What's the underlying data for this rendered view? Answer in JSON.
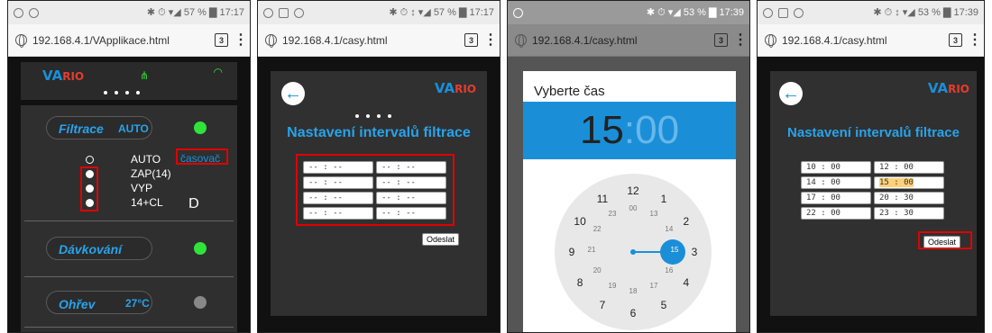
{
  "colors": {
    "accent": "#1a8fd8",
    "highlight_box": "#e00000",
    "led_on": "#2fe33a",
    "led_off": "#888888"
  },
  "screens": [
    {
      "status": {
        "left_icons": [
          "dnd-icon",
          "browser-icon"
        ],
        "right": "✱ ⏱ ▾◢ 57 % ▇ 17:17"
      },
      "url": "192.168.4.1/VApplikace.html",
      "tab_count": "3",
      "logo": {
        "main": "VA",
        "accent": "RIO"
      },
      "sections": [
        {
          "name": "Filtrace",
          "value": "AUTO",
          "led": "on"
        },
        {
          "name": "Dávkování",
          "value": "",
          "led": "on"
        },
        {
          "name": "Ohřev",
          "value": "27°C",
          "led": "off"
        }
      ],
      "options": [
        "AUTO",
        "ZAP(14)",
        "VYP",
        "14+CL"
      ],
      "timer_link": "časovač",
      "collapse_icon": "Ɑ"
    },
    {
      "status": {
        "left_icons": [
          "dnd-icon",
          "image-icon",
          "browser-icon"
        ],
        "right": "✱ ⏱ ↕ ▾◢ 57 % ▇ 17:17"
      },
      "url": "192.168.4.1/casy.html",
      "tab_count": "3",
      "logo": {
        "main": "VA",
        "accent": "RIO"
      },
      "title": "Nastavení intervalů filtrace",
      "intervals": [
        [
          "-- : --",
          "-- : --"
        ],
        [
          "-- : --",
          "-- : --"
        ],
        [
          "-- : --",
          "-- : --"
        ],
        [
          "-- : --",
          "-- : --"
        ]
      ],
      "send_label": "Odeslat"
    },
    {
      "status": {
        "left_icons": [
          "dnd-icon"
        ],
        "right": "✱ ⏱ ▾◢ 53 % ▇ 17:39"
      },
      "url": "192.168.4.1/casy.html",
      "tab_count": "3",
      "picker_title": "Vyberte čas",
      "hour": "15",
      "minute": ":00",
      "outer_numbers": [
        "12",
        "1",
        "2",
        "3",
        "4",
        "5",
        "6",
        "7",
        "8",
        "9",
        "10",
        "11"
      ],
      "inner_numbers": [
        "00",
        "13",
        "14",
        "15",
        "16",
        "17",
        "18",
        "19",
        "20",
        "21",
        "22",
        "23"
      ],
      "selected_hour": "15"
    },
    {
      "status": {
        "left_icons": [
          "dnd-icon",
          "image-icon",
          "browser-icon"
        ],
        "right": "✱ ⏱ ↕ ▾◢ 53 % ▇ 17:39"
      },
      "url": "192.168.4.1/casy.html",
      "tab_count": "3",
      "logo": {
        "main": "VA",
        "accent": "RIO"
      },
      "title": "Nastavení intervalů filtrace",
      "intervals": [
        [
          "10 : 00",
          "12 : 00"
        ],
        [
          "14 : 00",
          "15 : 00"
        ],
        [
          "17 : 00",
          "20 : 30"
        ],
        [
          "22 : 00",
          "23 : 30"
        ]
      ],
      "send_label": "Odeslat"
    }
  ]
}
